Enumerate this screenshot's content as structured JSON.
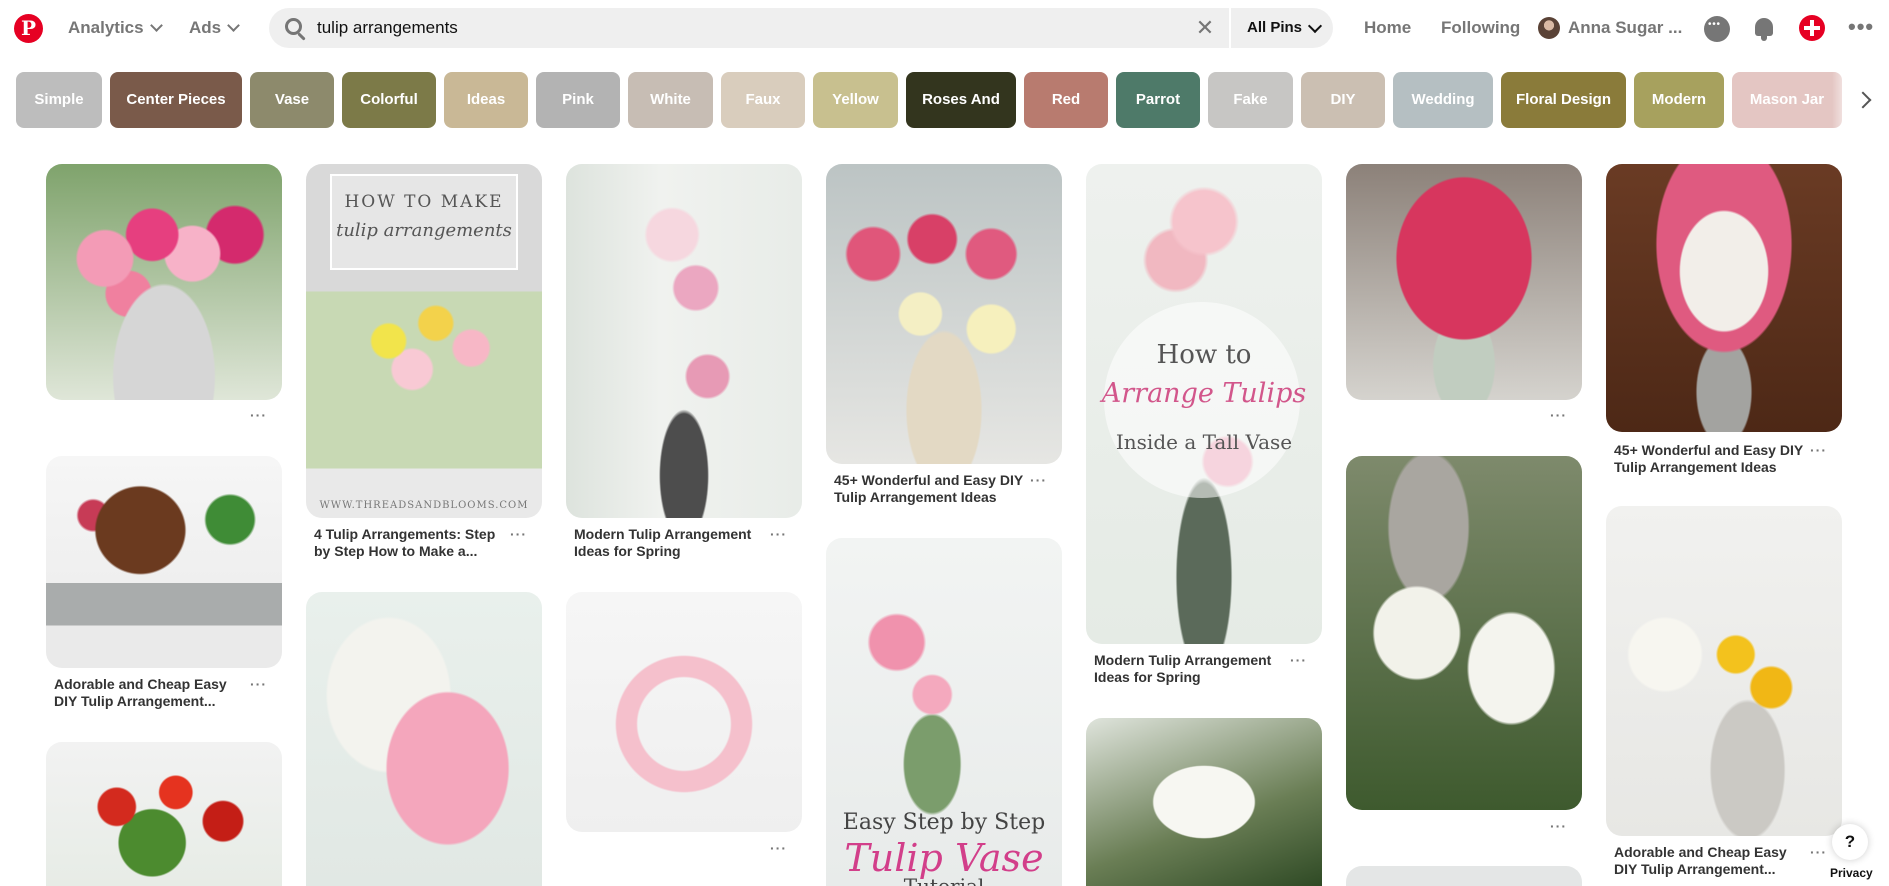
{
  "header": {
    "analytics_label": "Analytics",
    "ads_label": "Ads",
    "search_value": "tulip arrangements",
    "scope_label": "All Pins",
    "home_label": "Home",
    "following_label": "Following",
    "user_name": "Anna Sugar ...",
    "icons": [
      "pinterest-logo",
      "search-icon",
      "clear-icon",
      "chat-icon",
      "bell-icon",
      "create-icon",
      "more-icon"
    ],
    "brand_color": "#e60023"
  },
  "guides": [
    {
      "label": "Simple",
      "color": "#bdbdbd"
    },
    {
      "label": "Center Pieces",
      "color": "#7a5a4a"
    },
    {
      "label": "Vase",
      "color": "#8d8a6c"
    },
    {
      "label": "Colorful",
      "color": "#7c7a48"
    },
    {
      "label": "Ideas",
      "color": "#c9b896"
    },
    {
      "label": "Pink",
      "color": "#b3b3b3"
    },
    {
      "label": "White",
      "color": "#c7bdb4"
    },
    {
      "label": "Faux",
      "color": "#d9cdbd"
    },
    {
      "label": "Yellow",
      "color": "#c8c08f"
    },
    {
      "label": "Roses And",
      "color": "#33351e"
    },
    {
      "label": "Red",
      "color": "#b87b6f"
    },
    {
      "label": "Parrot",
      "color": "#4e7a69"
    },
    {
      "label": "Fake",
      "color": "#c7c6c4"
    },
    {
      "label": "DIY",
      "color": "#cbbfb2"
    },
    {
      "label": "Wedding",
      "color": "#b5bfc2"
    },
    {
      "label": "Floral Design",
      "color": "#8a7b3a"
    },
    {
      "label": "Modern",
      "color": "#a7a15e"
    },
    {
      "label": "Mason Jar",
      "color": "#e4c6c3"
    }
  ],
  "pins": {
    "c2p1_text1": "HOW TO MAKE",
    "c2p1_text2": "tulip arrangements",
    "c2p1_text3": "WWW.THREADSANDBLOOMS.COM",
    "c2p1_title": "4 Tulip Arrangements: Step by Step How to Make a...",
    "c3p1_title": "Modern Tulip Arrangement Ideas for Spring",
    "c4p1_title": "45+ Wonderful and Easy DIY Tulip Arrangement Ideas",
    "c4p2_text1": "Easy Step by Step",
    "c4p2_text2": "Tulip Vase",
    "c4p2_text3": "Tutorial",
    "c5p1_text1": "How to",
    "c5p1_text2": "Arrange Tulips",
    "c5p1_text3": "Inside a Tall Vase",
    "c5p1_title": "Modern Tulip Arrangement Ideas for Spring",
    "c1p2_title": "Adorable and Cheap Easy DIY Tulip Arrangement...",
    "c7p1_title": "45+ Wonderful and Easy DIY Tulip Arrangement Ideas",
    "c7p2_title": "Adorable and Cheap Easy DIY Tulip Arrangement...",
    "more_label": "···"
  },
  "footer": {
    "help_label": "?",
    "privacy_label": "Privacy"
  }
}
